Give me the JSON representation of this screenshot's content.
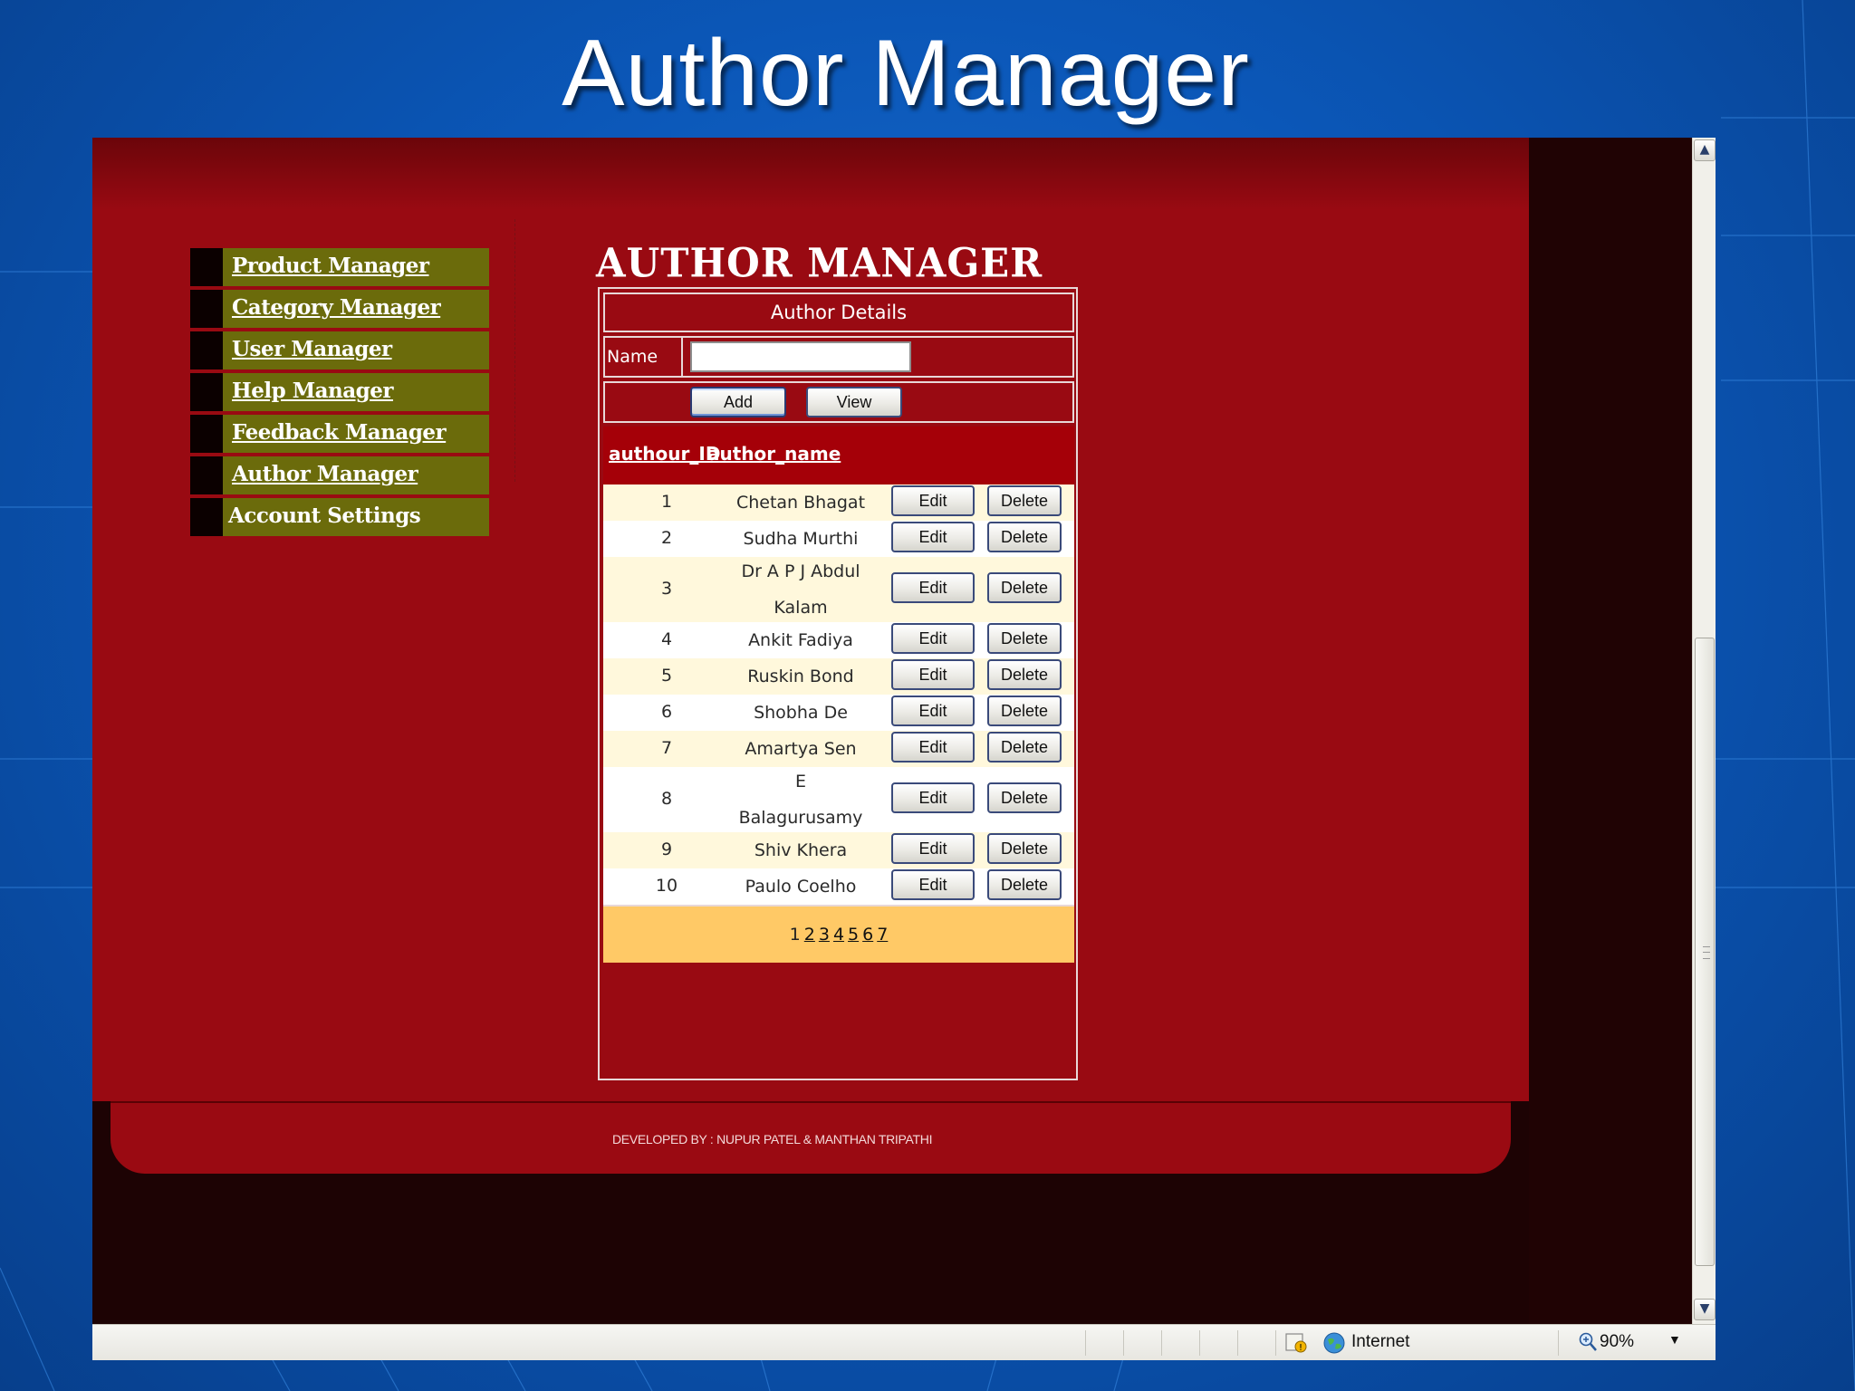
{
  "slide": {
    "title": "Author Manager"
  },
  "nav": {
    "items": [
      {
        "label": "Product Manager",
        "link": true
      },
      {
        "label": "Category Manager",
        "link": true
      },
      {
        "label": "User Manager",
        "link": true
      },
      {
        "label": "Help Manager",
        "link": true
      },
      {
        "label": "Feedback Manager",
        "link": true
      },
      {
        "label": "Author Manager",
        "link": true
      },
      {
        "label": "Account Settings",
        "link": false
      }
    ]
  },
  "main": {
    "heading": "AUTHOR MANAGER",
    "details_header": "Author Details",
    "name_label": "Name",
    "name_value": "",
    "add_label": "Add",
    "view_label": "View",
    "columns": [
      "authour_ID",
      "author_name"
    ],
    "rows": [
      {
        "id": "1",
        "name": [
          "Chetan Bhagat"
        ]
      },
      {
        "id": "2",
        "name": [
          "Sudha Murthi"
        ]
      },
      {
        "id": "3",
        "name": [
          "Dr A P J Abdul",
          "Kalam"
        ]
      },
      {
        "id": "4",
        "name": [
          "Ankit Fadiya"
        ]
      },
      {
        "id": "5",
        "name": [
          "Ruskin Bond"
        ]
      },
      {
        "id": "6",
        "name": [
          "Shobha De"
        ]
      },
      {
        "id": "7",
        "name": [
          "Amartya Sen"
        ]
      },
      {
        "id": "8",
        "name": [
          "E",
          "Balagurusamy"
        ]
      },
      {
        "id": "9",
        "name": [
          "Shiv Khera"
        ]
      },
      {
        "id": "10",
        "name": [
          "Paulo Coelho"
        ]
      }
    ],
    "edit_label": "Edit",
    "delete_label": "Delete",
    "pager": {
      "current": "1",
      "pages": [
        "2",
        "3",
        "4",
        "5",
        "6",
        "7"
      ]
    }
  },
  "footer": {
    "text": "DEVELOPED BY : NUPUR PATEL & MANTHAN TRIPATHI"
  },
  "statusbar": {
    "zone": "Internet",
    "zoom": "90%",
    "zone_icon": "globe-icon",
    "security_icon": "lock-warning-icon"
  },
  "colors": {
    "page_red": "#990a12",
    "nav_olive": "#6b6b0b",
    "row_cream": "#fff8dc",
    "pager_gold": "#ffc966",
    "slide_blue": "#0b57b8"
  }
}
